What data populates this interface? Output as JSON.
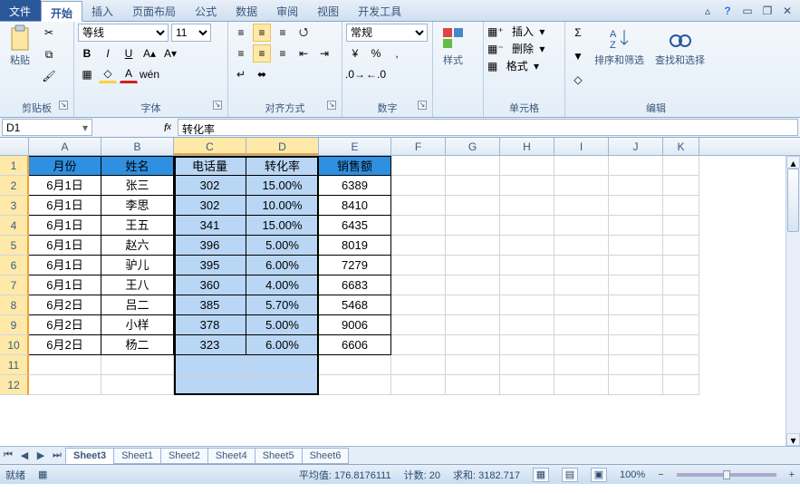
{
  "menu": {
    "file": "文件",
    "tabs": [
      "开始",
      "插入",
      "页面布局",
      "公式",
      "数据",
      "审阅",
      "视图",
      "开发工具"
    ],
    "activeTab": "开始"
  },
  "ribbon": {
    "clipboard": {
      "label": "剪贴板",
      "paste": "粘贴"
    },
    "font": {
      "label": "字体",
      "name": "等线",
      "size": "11"
    },
    "align": {
      "label": "对齐方式"
    },
    "number": {
      "label": "数字",
      "format": "常规"
    },
    "styles": {
      "label": "样式",
      "btn": "样式"
    },
    "cells": {
      "label": "单元格",
      "insert": "插入",
      "delete": "删除",
      "format": "格式"
    },
    "editing": {
      "label": "编辑",
      "sort": "排序和筛选",
      "find": "查找和选择"
    }
  },
  "fx": {
    "namebox": "D1",
    "formula": "转化率"
  },
  "columns": [
    "A",
    "B",
    "C",
    "D",
    "E",
    "F",
    "G",
    "H",
    "I",
    "J",
    "K"
  ],
  "rows": [
    1,
    2,
    3,
    4,
    5,
    6,
    7,
    8,
    9,
    10,
    11,
    12
  ],
  "selectedCols": [
    "C",
    "D"
  ],
  "selectedRows": [
    1,
    2,
    3,
    4,
    5,
    6,
    7,
    8,
    9,
    10,
    11,
    12
  ],
  "activeCell": "D1",
  "headerRow": [
    "月份",
    "姓名",
    "电话量",
    "转化率",
    "销售额"
  ],
  "data": [
    [
      "6月1日",
      "张三",
      "302",
      "15.00%",
      "6389"
    ],
    [
      "6月1日",
      "李思",
      "302",
      "10.00%",
      "8410"
    ],
    [
      "6月1日",
      "王五",
      "341",
      "15.00%",
      "6435"
    ],
    [
      "6月1日",
      "赵六",
      "396",
      "5.00%",
      "8019"
    ],
    [
      "6月1日",
      "驴儿",
      "395",
      "6.00%",
      "7279"
    ],
    [
      "6月1日",
      "王八",
      "360",
      "4.00%",
      "6683"
    ],
    [
      "6月2日",
      "吕二",
      "385",
      "5.70%",
      "5468"
    ],
    [
      "6月2日",
      "小样",
      "378",
      "5.00%",
      "9006"
    ],
    [
      "6月2日",
      "杨二",
      "323",
      "6.00%",
      "6606"
    ]
  ],
  "sheets": [
    "Sheet3",
    "Sheet1",
    "Sheet2",
    "Sheet4",
    "Sheet5",
    "Sheet6"
  ],
  "activeSheet": "Sheet3",
  "status": {
    "ready": "就绪",
    "avg_label": "平均值:",
    "avg": "176.8176111",
    "count_label": "计数:",
    "count": "20",
    "sum_label": "求和:",
    "sum": "3182.717",
    "zoom": "100%"
  },
  "chart_data": {
    "type": "table",
    "title": "",
    "columns": [
      "月份",
      "姓名",
      "电话量",
      "转化率",
      "销售额"
    ],
    "rows": [
      {
        "月份": "6月1日",
        "姓名": "张三",
        "电话量": 302,
        "转化率": 0.15,
        "销售额": 6389
      },
      {
        "月份": "6月1日",
        "姓名": "李思",
        "电话量": 302,
        "转化率": 0.1,
        "销售额": 8410
      },
      {
        "月份": "6月1日",
        "姓名": "王五",
        "电话量": 341,
        "转化率": 0.15,
        "销售额": 6435
      },
      {
        "月份": "6月1日",
        "姓名": "赵六",
        "电话量": 396,
        "转化率": 0.05,
        "销售额": 8019
      },
      {
        "月份": "6月1日",
        "姓名": "驴儿",
        "电话量": 395,
        "转化率": 0.06,
        "销售额": 7279
      },
      {
        "月份": "6月1日",
        "姓名": "王八",
        "电话量": 360,
        "转化率": 0.04,
        "销售额": 6683
      },
      {
        "月份": "6月2日",
        "姓名": "吕二",
        "电话量": 385,
        "转化率": 0.057,
        "销售额": 5468
      },
      {
        "月份": "6月2日",
        "姓名": "小样",
        "电话量": 378,
        "转化率": 0.05,
        "销售额": 9006
      },
      {
        "月份": "6月2日",
        "姓名": "杨二",
        "电话量": 323,
        "转化率": 0.06,
        "销售额": 6606
      }
    ]
  }
}
